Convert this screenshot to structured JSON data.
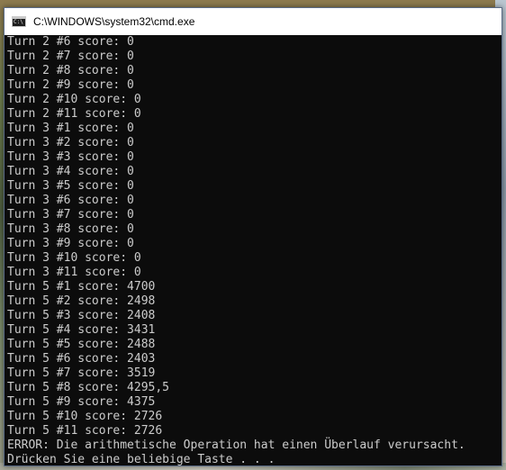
{
  "window": {
    "title": "C:\\WINDOWS\\system32\\cmd.exe",
    "icon": "cmd-icon"
  },
  "console": {
    "lines": [
      "Turn 2 #6 score: 0",
      "Turn 2 #7 score: 0",
      "Turn 2 #8 score: 0",
      "Turn 2 #9 score: 0",
      "Turn 2 #10 score: 0",
      "Turn 2 #11 score: 0",
      "Turn 3 #1 score: 0",
      "Turn 3 #2 score: 0",
      "Turn 3 #3 score: 0",
      "Turn 3 #4 score: 0",
      "Turn 3 #5 score: 0",
      "Turn 3 #6 score: 0",
      "Turn 3 #7 score: 0",
      "Turn 3 #8 score: 0",
      "Turn 3 #9 score: 0",
      "Turn 3 #10 score: 0",
      "Turn 3 #11 score: 0",
      "Turn 5 #1 score: 4700",
      "Turn 5 #2 score: 2498",
      "Turn 5 #3 score: 2408",
      "Turn 5 #4 score: 3431",
      "Turn 5 #5 score: 2488",
      "Turn 5 #6 score: 2403",
      "Turn 5 #7 score: 3519",
      "Turn 5 #8 score: 4295,5",
      "Turn 5 #9 score: 4375",
      "Turn 5 #10 score: 2726",
      "Turn 5 #11 score: 2726",
      "ERROR: Die arithmetische Operation hat einen Überlauf verursacht.",
      "Drücken Sie eine beliebige Taste . . ."
    ],
    "colors": {
      "background": "#0c0c0c",
      "text": "#cccccc"
    }
  }
}
